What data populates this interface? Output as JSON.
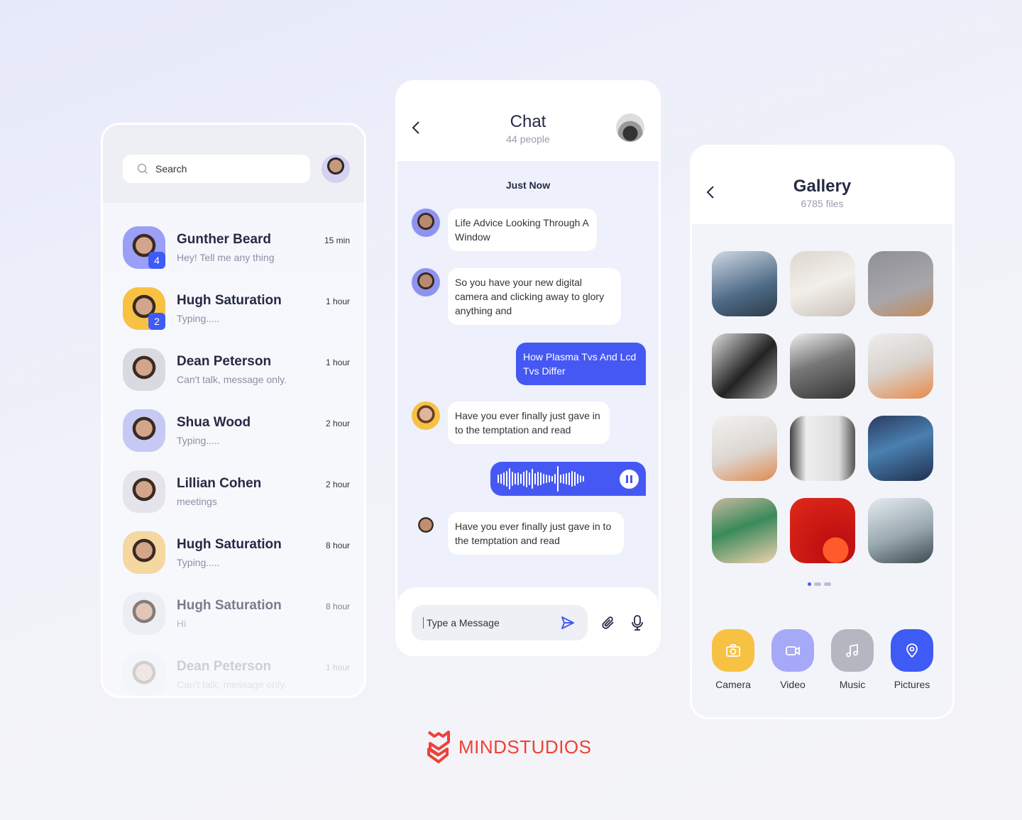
{
  "contacts": {
    "search_placeholder": "Search",
    "items": [
      {
        "name": "Gunther Beard",
        "message": "Hey! Tell me any thing",
        "time": "15 min",
        "badge": "4"
      },
      {
        "name": "Hugh Saturation",
        "message": "Typing.....",
        "time": "1 hour",
        "badge": "2"
      },
      {
        "name": "Dean Peterson",
        "message": "Can't talk, message only.",
        "time": "1 hour"
      },
      {
        "name": "Shua Wood",
        "message": "Typing.....",
        "time": "2 hour"
      },
      {
        "name": "Lillian Cohen",
        "message": "meetings",
        "time": "2 hour"
      },
      {
        "name": "Hugh Saturation",
        "message": "Typing.....",
        "time": "8 hour"
      },
      {
        "name": "Hugh Saturation",
        "message": "Hi",
        "time": "8 hour"
      },
      {
        "name": "Dean Peterson",
        "message": "Can't talk, message only.",
        "time": "1 hour"
      }
    ]
  },
  "chat": {
    "title": "Chat",
    "subtitle": "44 people",
    "divider": "Just Now",
    "messages": [
      {
        "text": "Life Advice Looking Through A Window",
        "direction": "in"
      },
      {
        "text": "So you have your new digital camera and clicking away to glory anything and",
        "direction": "in"
      },
      {
        "text": "How Plasma Tvs And Lcd Tvs Differ",
        "direction": "out"
      },
      {
        "text": "Have you ever finally just gave in to the temptation and read",
        "direction": "in"
      },
      {
        "text": "Have you ever finally just gave in to the temptation and read",
        "direction": "in"
      }
    ],
    "input_placeholder": "Type a Message"
  },
  "gallery": {
    "title": "Gallery",
    "subtitle": "6785 files",
    "actions": [
      {
        "label": "Camera",
        "icon": "camera-icon",
        "color": "#f7c244"
      },
      {
        "label": "Video",
        "icon": "video-icon",
        "color": "#a6a9f7"
      },
      {
        "label": "Music",
        "icon": "music-icon",
        "color": "#b4b6c0"
      },
      {
        "label": "Pictures",
        "icon": "location-pin-icon",
        "color": "#3e5bf5"
      }
    ]
  },
  "brand": {
    "logo_text": "MINDSTUDIOS",
    "color": "#ef4136"
  },
  "accent": "#4558f4"
}
